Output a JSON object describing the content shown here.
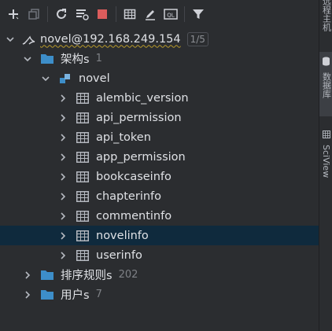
{
  "toolbar": {
    "buttons": [
      {
        "icon": "add-icon"
      },
      {
        "icon": "copy-icon"
      },
      {
        "icon": "refresh-icon"
      },
      {
        "icon": "schema-settings-icon"
      },
      {
        "icon": "stop-icon"
      },
      {
        "icon": "table-view-icon"
      },
      {
        "icon": "edit-icon"
      },
      {
        "icon": "sql-console-icon",
        "text": "QL"
      },
      {
        "icon": "filter-icon"
      }
    ]
  },
  "tree": {
    "connection": {
      "label": "novel@192.168.249.154",
      "badge": "1/5"
    },
    "schemas_folder": {
      "label": "架构s",
      "count": "1"
    },
    "schema": {
      "label": "novel"
    },
    "tables": [
      "alembic_version",
      "api_permission",
      "api_token",
      "app_permission",
      "bookcaseinfo",
      "chapterinfo",
      "commentinfo",
      "novelinfo",
      "userinfo"
    ],
    "collations_folder": {
      "label": "排序规则s",
      "count": "202"
    },
    "users_folder": {
      "label": "用户s",
      "count": "7"
    }
  },
  "sidebar": {
    "tabs": [
      {
        "label": "远程主机"
      },
      {
        "label": "数据库"
      },
      {
        "label": "SciView"
      }
    ]
  },
  "colors": {
    "background": "#2b2d30",
    "selected_row": "#0f2a3d",
    "folder_blue": "#3d8ec9",
    "stop_red": "#db5c5c"
  }
}
